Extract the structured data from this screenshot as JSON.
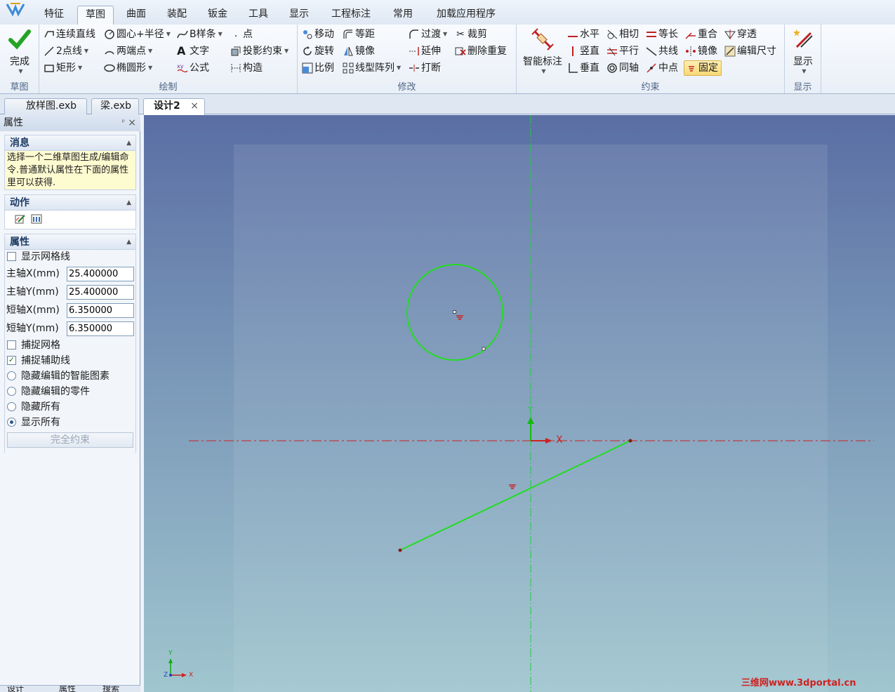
{
  "ribbon_tabs": [
    "特征",
    "草图",
    "曲面",
    "装配",
    "钣金",
    "工具",
    "显示",
    "工程标注",
    "常用",
    "加载应用程序"
  ],
  "active_tab": "草图",
  "groups": {
    "sketch": "草图",
    "draw": "绘制",
    "modify": "修改",
    "constraint": "约束",
    "display": "显示"
  },
  "commands": {
    "finish": "完成",
    "polyline": "连续直线",
    "line2pt": "2点线",
    "rect": "矩形",
    "circle": "圆心+半径",
    "arc2pt": "两端点",
    "ellipse": "椭圆形",
    "bspline": "B样条",
    "text": "文字",
    "formula": "公式",
    "point": "点",
    "projection": "投影约束",
    "construct": "构造",
    "move": "移动",
    "rotate": "旋转",
    "scale": "比例",
    "offset": "等距",
    "mirror": "镜像",
    "pattern": "线型阵列",
    "fillet": "过渡",
    "extend": "延伸",
    "break": "打断",
    "trim": "裁剪",
    "delete_dup": "删除重复",
    "smart_dim": "智能标注",
    "horizontal": "水平",
    "vertical": "竖直",
    "perpendicular": "垂直",
    "tangent": "相切",
    "parallel": "平行",
    "concentric": "同轴",
    "equal": "等长",
    "collinear": "共线",
    "midpoint": "中点",
    "coincident": "重合",
    "c_mirror": "镜像",
    "fixed": "固定",
    "pierce": "穿透",
    "edit_dim": "编辑尺寸",
    "display": "显示"
  },
  "doc_tabs": [
    "放样图.exb",
    "梁.exb",
    "设计2"
  ],
  "active_doc": "设计2",
  "panel": {
    "title": "属性",
    "message_title": "消息",
    "message": "选择一个二维草图生成/编辑命令.普通默认属性在下面的属性里可以获得.",
    "action_title": "动作",
    "props_title": "属性",
    "show_grid": "显示网格线",
    "major_x_label": "主轴X(mm)",
    "major_x": "25.400000",
    "major_y_label": "主轴Y(mm)",
    "major_y": "25.400000",
    "minor_x_label": "短轴X(mm)",
    "minor_x": "6.350000",
    "minor_y_label": "短轴Y(mm)",
    "minor_y": "6.350000",
    "snap_grid": "捕捉网格",
    "snap_aux": "捕捉辅助线",
    "hide_smart": "隐藏编辑的智能图素",
    "hide_parts": "隐藏编辑的零件",
    "hide_all": "隐藏所有",
    "show_all": "显示所有",
    "full_constrain": "完全约束",
    "bottom_tabs": [
      "设计",
      "属性",
      "搜索"
    ]
  },
  "canvas": {
    "x_label": "X",
    "y_label": "Y",
    "triad_x": "X",
    "triad_y": "Y",
    "triad_z": "Z"
  },
  "watermark": "三维网www.3dportal.cn",
  "colors": {
    "sketch_green": "#22dd22",
    "axis_red": "#cc2222",
    "axis_green": "#11bb11"
  }
}
